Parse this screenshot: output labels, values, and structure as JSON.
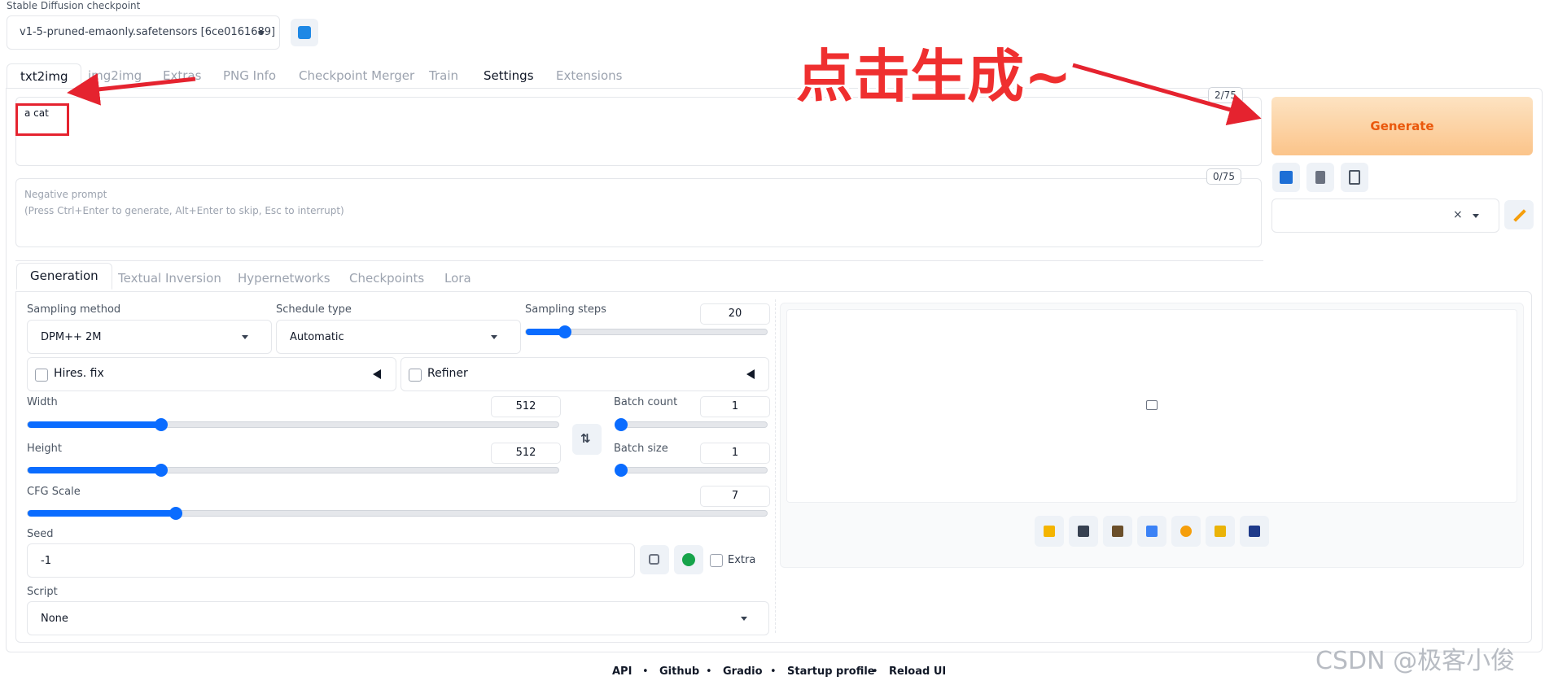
{
  "checkpoint": {
    "label": "Stable Diffusion checkpoint",
    "value": "v1-5-pruned-emaonly.safetensors [6ce0161689]"
  },
  "top_tabs": [
    "txt2img",
    "img2img",
    "Extras",
    "PNG Info",
    "Checkpoint Merger",
    "Train",
    "Settings",
    "Extensions"
  ],
  "prompt": {
    "value": "a cat",
    "counter": "2/75"
  },
  "negative_prompt": {
    "placeholder_line1": "Negative prompt",
    "placeholder_line2": "(Press Ctrl+Enter to generate, Alt+Enter to skip, Esc to interrupt)",
    "counter": "0/75"
  },
  "generate_label": "Generate",
  "sub_tabs": [
    "Generation",
    "Textual Inversion",
    "Hypernetworks",
    "Checkpoints",
    "Lora"
  ],
  "sampling_method": {
    "label": "Sampling method",
    "value": "DPM++ 2M"
  },
  "schedule_type": {
    "label": "Schedule type",
    "value": "Automatic"
  },
  "sampling_steps": {
    "label": "Sampling steps",
    "value": "20",
    "fraction": 0.16
  },
  "hires_fix_label": "Hires. fix",
  "refiner_label": "Refiner",
  "width": {
    "label": "Width",
    "value": "512",
    "fraction": 0.25
  },
  "height": {
    "label": "Height",
    "value": "512",
    "fraction": 0.25
  },
  "batch_count": {
    "label": "Batch count",
    "value": "1",
    "fraction": 0.0
  },
  "batch_size": {
    "label": "Batch size",
    "value": "1",
    "fraction": 0.0
  },
  "cfg_scale": {
    "label": "CFG Scale",
    "value": "7",
    "fraction": 0.2
  },
  "seed": {
    "label": "Seed",
    "value": "-1",
    "extra_label": "Extra"
  },
  "script": {
    "label": "Script",
    "value": "None"
  },
  "footer_links": [
    "API",
    "Github",
    "Gradio",
    "Startup profile",
    "Reload UI"
  ],
  "annotation": {
    "text": "点击生成~",
    "color": "#ef2f2f"
  },
  "watermark": "CSDN @极客小俊",
  "colors": {
    "accent": "#0a6cff",
    "generate_text": "#ea580c",
    "annotation": "#ef2f2f"
  }
}
